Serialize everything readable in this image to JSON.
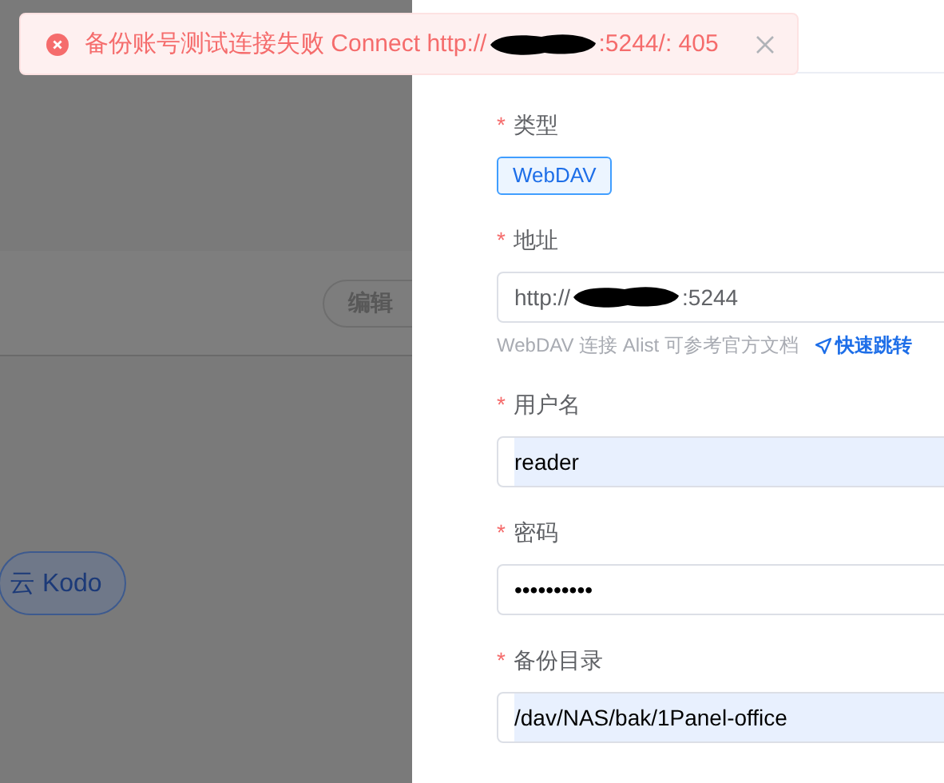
{
  "toast": {
    "kind": "error",
    "message_start": "备份账号测试连接失败 Connect http://",
    "message_end": ":5244/: 405",
    "redacted": true
  },
  "background": {
    "edit_button": "编辑",
    "kodo_button": "云 Kodo"
  },
  "drawer": {
    "fields": [
      {
        "kind": "tag",
        "label": "类型",
        "required_mark": "*",
        "value": "WebDAV"
      },
      {
        "kind": "input",
        "label": "地址",
        "required_mark": "*",
        "value_start": "http://",
        "value_end": ":5244",
        "redacted": true,
        "autofilled": false,
        "help": "WebDAV 连接 Alist 可参考官方文档",
        "link": "快速跳转"
      },
      {
        "kind": "input",
        "label": "用户名",
        "required_mark": "*",
        "value": "reader",
        "autofilled": true
      },
      {
        "kind": "input",
        "label": "密码",
        "required_mark": "*",
        "value": "••••••••••",
        "autofilled": false
      },
      {
        "kind": "input",
        "label": "备份目录",
        "required_mark": "*",
        "value": "/dav/NAS/bak/1Panel-office",
        "autofilled": true
      }
    ]
  }
}
